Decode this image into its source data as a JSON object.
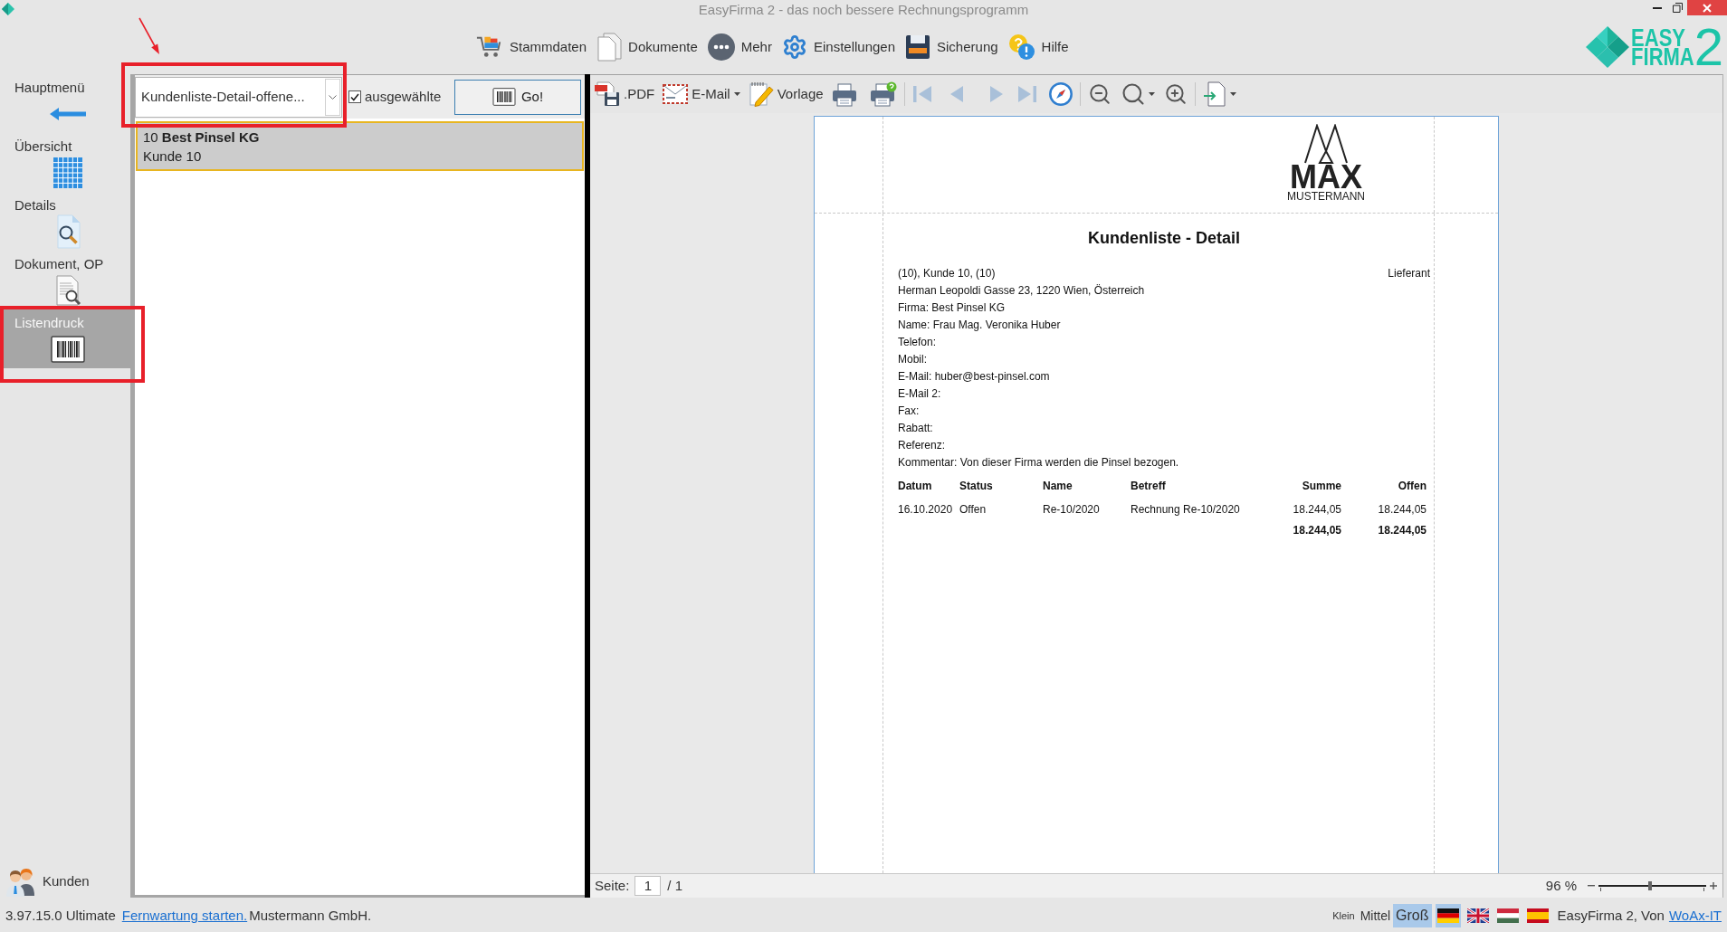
{
  "window": {
    "title": "EasyFirma 2 - das noch bessere Rechnungsprogramm"
  },
  "main_toolbar": [
    {
      "label": "Stammdaten"
    },
    {
      "label": "Dokumente"
    },
    {
      "label": "Mehr"
    },
    {
      "label": "Einstellungen"
    },
    {
      "label": "Sicherung"
    },
    {
      "label": "Hilfe"
    }
  ],
  "logo": {
    "line_1": "EASY",
    "line_2": "FIRMA",
    "digit": "2"
  },
  "sidebar": {
    "items": [
      {
        "label": "Hauptmenü",
        "selected": false,
        "highlighted": false
      },
      {
        "label": "Übersicht",
        "selected": false,
        "highlighted": false
      },
      {
        "label": "Details",
        "selected": false,
        "highlighted": false
      },
      {
        "label": "Dokument, OP",
        "selected": false,
        "highlighted": false
      },
      {
        "label": "Listendruck",
        "selected": true,
        "highlighted": true
      }
    ],
    "footer": {
      "label": "Kunden"
    }
  },
  "list_panel": {
    "report_select": {
      "value": "Kundenliste-Detail-offene...",
      "highlighted": true,
      "pointer_arrow": true
    },
    "selected_only": {
      "label": "ausgewählte",
      "checked": true
    },
    "go_button": {
      "label": "Go!"
    },
    "rows": [
      {
        "number": "10",
        "name": "Best Pinsel KG",
        "subtitle": "Kunde 10",
        "selected": true
      }
    ]
  },
  "preview_toolbar": [
    {
      "label": ".PDF",
      "has_menu": false
    },
    {
      "label": "E-Mail",
      "has_menu": true
    },
    {
      "label": "Vorlage",
      "has_menu": false
    }
  ],
  "document": {
    "company_logo": {
      "name": "MAX",
      "subtitle": "MUSTERMANN"
    },
    "title": "Kundenliste - Detail",
    "customer_line": "(10), Kunde 10, (10)",
    "role": "Lieferant",
    "lines": [
      "Herman Leopoldi Gasse 23, 1220 Wien, Österreich",
      "Firma: Best Pinsel KG",
      "Name: Frau Mag. Veronika Huber",
      "Telefon:",
      "Mobil:",
      "E-Mail: huber@best-pinsel.com",
      "E-Mail 2:",
      "Fax:",
      "Rabatt:",
      "Referenz:",
      "Kommentar: Von dieser Firma werden die Pinsel bezogen."
    ],
    "table": {
      "columns": [
        "Datum",
        "Status",
        "Name",
        "Betreff",
        "Summe",
        "Offen"
      ],
      "rows": [
        [
          "16.10.2020",
          "Offen",
          "Re-10/2020",
          "Rechnung Re-10/2020",
          "18.244,05",
          "18.244,05"
        ]
      ],
      "totals": [
        "18.244,05",
        "18.244,05"
      ]
    }
  },
  "page_bar": {
    "label": "Seite:",
    "page": "1",
    "total": "/ 1",
    "zoom": "96 %",
    "zoom_slider": {
      "level": 0.48
    }
  },
  "status_bar": {
    "version": "3.97.15.0 Ultimate",
    "remote_link": "Fernwartung starten.",
    "company": "Mustermann GmbH.",
    "text_sizes": [
      {
        "label": "Klein",
        "kind": "small",
        "selected": false
      },
      {
        "label": "Mittel",
        "kind": "medium",
        "selected": false
      },
      {
        "label": "Groß",
        "kind": "large",
        "selected": true
      }
    ],
    "languages": [
      {
        "selected": true
      },
      {
        "selected": false
      },
      {
        "selected": false
      },
      {
        "selected": false
      }
    ],
    "credit": "EasyFirma 2, Von",
    "credit_link": "WoAx-IT"
  }
}
